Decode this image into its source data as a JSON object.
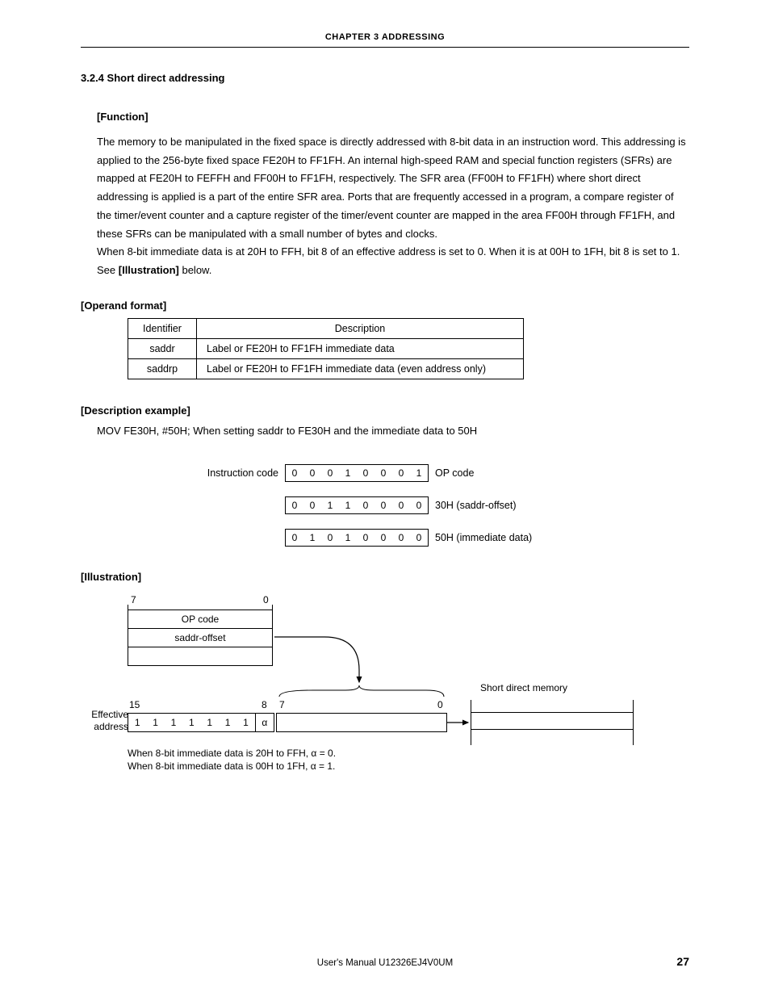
{
  "header": {
    "chapter": "CHAPTER 3   ADDRESSING"
  },
  "section": {
    "number_title": "3.2.4   Short direct addressing",
    "function_label": "[Function]",
    "function_text": "The memory to be manipulated in the fixed space is directly addressed with 8-bit data in an instruction word. This addressing is applied to the 256-byte fixed space FE20H to FF1FH.  An internal high-speed RAM and special function registers (SFRs) are mapped at FE20H to FEFFH and FF00H to FF1FH, respectively. The SFR area (FF00H to FF1FH) where short direct addressing is applied is a part of the entire SFR area.  Ports that are frequently accessed in a program, a compare register of the timer/event counter and a capture register of the timer/event counter are mapped in the area FF00H through FF1FH, and these SFRs can be manipulated with a small number of bytes and clocks.",
    "function_text2": "When 8-bit immediate data is at 20H to FFH, bit 8 of an effective address is set to 0.  When it is at 00H to 1FH, bit 8 is set to 1.  See ",
    "function_illus_ref": "[Illustration]",
    "function_below": " below.",
    "operand_label": "[Operand format]",
    "table": {
      "head_identifier": "Identifier",
      "head_description": "Description",
      "rows": [
        {
          "id": "saddr",
          "desc": "Label or FE20H to FF1FH immediate data"
        },
        {
          "id": "saddrp",
          "desc": "Label or FE20H to FF1FH immediate data (even address only)"
        }
      ]
    },
    "desc_ex_label": "[Description example]",
    "desc_ex_text": "MOV FE30H, #50H; When setting saddr to FE30H and the immediate data to 50H",
    "instruction": {
      "label": "Instruction code",
      "rows": [
        {
          "bits": [
            "0",
            "0",
            "0",
            "1",
            "0",
            "0",
            "0",
            "1"
          ],
          "note": "OP code"
        },
        {
          "bits": [
            "0",
            "0",
            "1",
            "1",
            "0",
            "0",
            "0",
            "0"
          ],
          "note": "30H (saddr-offset)"
        },
        {
          "bits": [
            "0",
            "1",
            "0",
            "1",
            "0",
            "0",
            "0",
            "0"
          ],
          "note": "50H (immediate data)"
        }
      ]
    },
    "illustration_label": "[Illustration]",
    "illustration": {
      "tick7": "7",
      "tick0": "0",
      "opcode_label": "OP code",
      "saddr_offset_label": "saddr-offset",
      "tick15": "15",
      "tick8": "8",
      "tick7b": "7",
      "tick0b": "0",
      "eff_addr_label_line1": "Effective",
      "eff_addr_label_line2": "address",
      "eff_bits": [
        "1",
        "1",
        "1",
        "1",
        "1",
        "1",
        "1"
      ],
      "alpha": "α",
      "short_mem_label": "Short direct memory",
      "footnote1": "When 8-bit immediate data is 20H to FFH, α = 0.",
      "footnote2": "When 8-bit immediate data is 00H to 1FH, α = 1."
    }
  },
  "footer": {
    "manual": "User's Manual  U12326EJ4V0UM",
    "page": "27"
  }
}
